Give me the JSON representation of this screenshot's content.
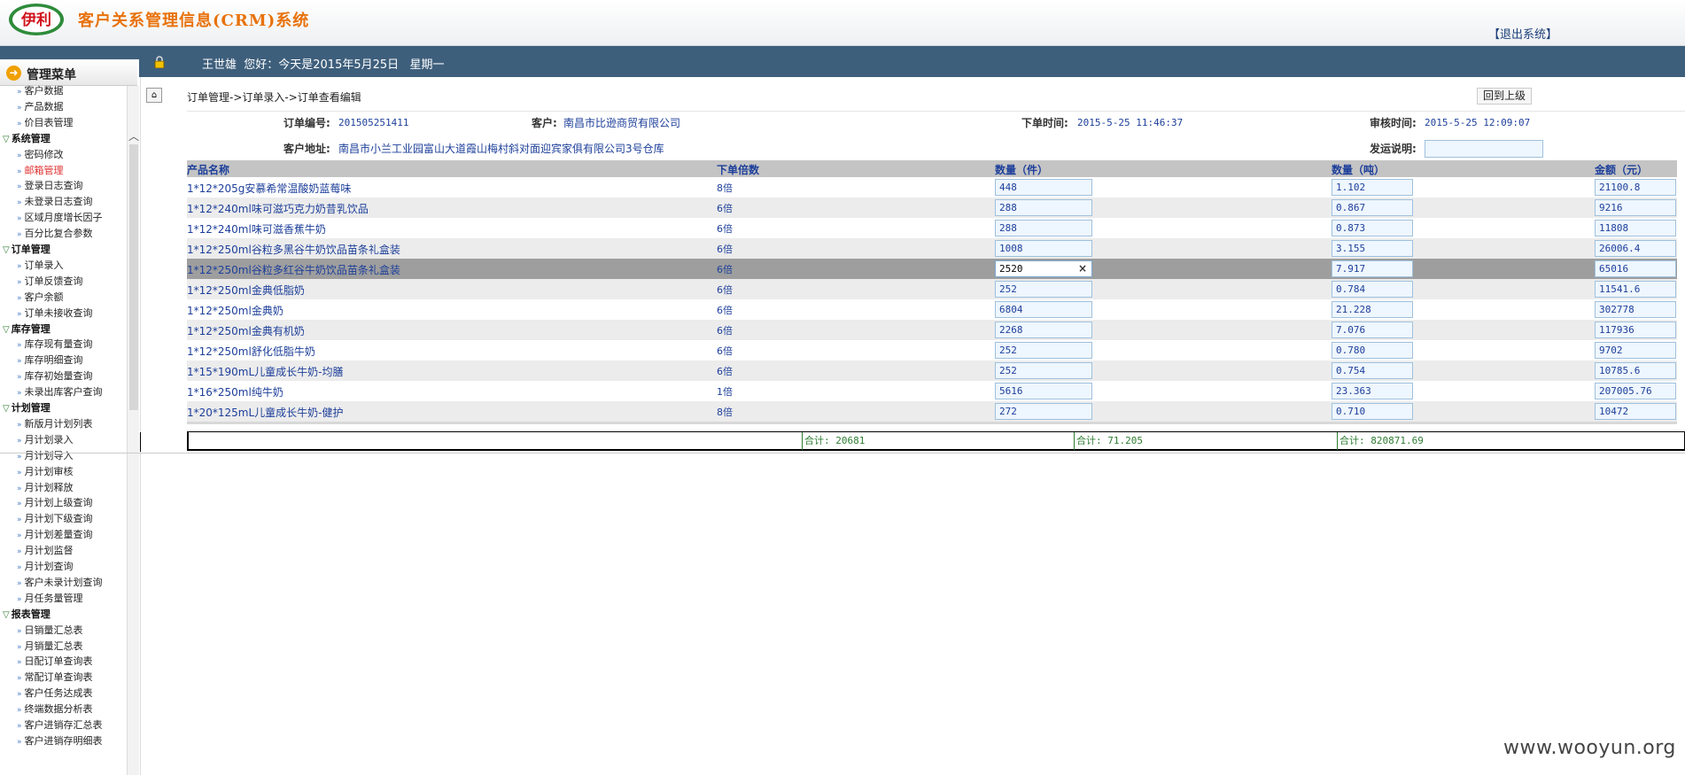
{
  "header": {
    "logo_text": "伊利",
    "title": "客户关系管理信息(CRM)系统",
    "logout": "【退出系统】",
    "brand_color": "#e8720c"
  },
  "topbar": {
    "greeting": "王世雄  您好：今天是2015年5月25日   星期一"
  },
  "sidebar": {
    "title": "管理菜单",
    "items": [
      {
        "type": "item",
        "label": "客户数据"
      },
      {
        "type": "item",
        "label": "产品数据"
      },
      {
        "type": "item",
        "label": "价目表管理"
      },
      {
        "type": "group",
        "label": "系统管理"
      },
      {
        "type": "item",
        "label": "密码修改"
      },
      {
        "type": "item",
        "label": "邮箱管理",
        "active": true
      },
      {
        "type": "item",
        "label": "登录日志查询"
      },
      {
        "type": "item",
        "label": "未登录日志查询"
      },
      {
        "type": "item",
        "label": "区域月度增长因子"
      },
      {
        "type": "item",
        "label": "百分比复合参数"
      },
      {
        "type": "group",
        "label": "订单管理"
      },
      {
        "type": "item",
        "label": "订单录入"
      },
      {
        "type": "item",
        "label": "订单反馈查询"
      },
      {
        "type": "item",
        "label": "客户余额"
      },
      {
        "type": "item",
        "label": "订单未接收查询"
      },
      {
        "type": "group",
        "label": "库存管理"
      },
      {
        "type": "item",
        "label": "库存现有量查询"
      },
      {
        "type": "item",
        "label": "库存明细查询"
      },
      {
        "type": "item",
        "label": "库存初始量查询"
      },
      {
        "type": "item",
        "label": "未录出库客户查询"
      },
      {
        "type": "group",
        "label": "计划管理"
      },
      {
        "type": "item",
        "label": "新版月计划列表"
      },
      {
        "type": "item",
        "label": "月计划录入"
      },
      {
        "type": "item",
        "label": "月计划导入"
      },
      {
        "type": "item",
        "label": "月计划审核"
      },
      {
        "type": "item",
        "label": "月计划释放"
      },
      {
        "type": "item",
        "label": "月计划上级查询"
      },
      {
        "type": "item",
        "label": "月计划下级查询"
      },
      {
        "type": "item",
        "label": "月计划差量查询"
      },
      {
        "type": "item",
        "label": "月计划监督"
      },
      {
        "type": "item",
        "label": "月计划查询"
      },
      {
        "type": "item",
        "label": "客户未录计划查询"
      },
      {
        "type": "item",
        "label": "月任务量管理"
      },
      {
        "type": "group",
        "label": "报表管理"
      },
      {
        "type": "item",
        "label": "日销量汇总表"
      },
      {
        "type": "item",
        "label": "月销量汇总表"
      },
      {
        "type": "item",
        "label": "日配订单查询表"
      },
      {
        "type": "item",
        "label": "常配订单查询表"
      },
      {
        "type": "item",
        "label": "客户任务达成表"
      },
      {
        "type": "item",
        "label": "终端数据分析表"
      },
      {
        "type": "item",
        "label": "客户进销存汇总表"
      },
      {
        "type": "item",
        "label": "客户进销存明细表"
      }
    ]
  },
  "main": {
    "breadcrumb": "订单管理->订单录入->订单查看编辑",
    "back_button": "回到上级",
    "order": {
      "number_label": "订单编号:",
      "number": "201505251411",
      "customer_label": "客户:",
      "customer": "南昌市比逊商贸有限公司",
      "order_time_label": "下单时间:",
      "order_time": "2015-5-25 11:46:37",
      "review_time_label": "审核时间:",
      "review_time": "2015-5-25 12:09:07",
      "address_label": "客户地址:",
      "address": "南昌市小兰工业园富山大道霞山梅村斜对面迎宾家俱有限公司3号仓库",
      "shipping_label": "发运说明:",
      "shipping_value": ""
    },
    "table": {
      "columns": [
        "产品名称",
        "下单倍数",
        "数量（件）",
        "数量（吨）",
        "金额（元）"
      ],
      "rows": [
        {
          "name": "1*12*205g安慕希常温酸奶蓝莓味",
          "mult": "8倍",
          "qty": "448",
          "tons": "1.102",
          "amount": "21100.8"
        },
        {
          "name": "1*12*240ml味可滋巧克力奶昔乳饮品",
          "mult": "6倍",
          "qty": "288",
          "tons": "0.867",
          "amount": "9216"
        },
        {
          "name": "1*12*240ml味可滋香蕉牛奶",
          "mult": "6倍",
          "qty": "288",
          "tons": "0.873",
          "amount": "11808"
        },
        {
          "name": "1*12*250ml谷粒多黑谷牛奶饮品苗条礼盒装",
          "mult": "6倍",
          "qty": "1008",
          "tons": "3.155",
          "amount": "26006.4"
        },
        {
          "name": "1*12*250ml谷粒多红谷牛奶饮品苗条礼盒装",
          "mult": "6倍",
          "qty": "2520",
          "tons": "7.917",
          "amount": "65016",
          "selected": true
        },
        {
          "name": "1*12*250ml金典低脂奶",
          "mult": "6倍",
          "qty": "252",
          "tons": "0.784",
          "amount": "11541.6"
        },
        {
          "name": "1*12*250ml金典奶",
          "mult": "6倍",
          "qty": "6804",
          "tons": "21.228",
          "amount": "302778"
        },
        {
          "name": "1*12*250ml金典有机奶",
          "mult": "6倍",
          "qty": "2268",
          "tons": "7.076",
          "amount": "117936"
        },
        {
          "name": "1*12*250ml舒化低脂牛奶",
          "mult": "6倍",
          "qty": "252",
          "tons": "0.780",
          "amount": "9702"
        },
        {
          "name": "1*15*190mL儿童成长牛奶-均膳",
          "mult": "6倍",
          "qty": "252",
          "tons": "0.754",
          "amount": "10785.6"
        },
        {
          "name": "1*16*250ml纯牛奶",
          "mult": "1倍",
          "qty": "5616",
          "tons": "23.363",
          "amount": "207005.76"
        },
        {
          "name": "1*20*125mL儿童成长牛奶-健护",
          "mult": "8倍",
          "qty": "272",
          "tons": "0.710",
          "amount": "10472"
        }
      ]
    },
    "totals": {
      "qty": "合计: 20681",
      "tons": "合计: 71.205",
      "amount": "合计: 820871.69"
    }
  },
  "watermark": "www.wooyun.org"
}
